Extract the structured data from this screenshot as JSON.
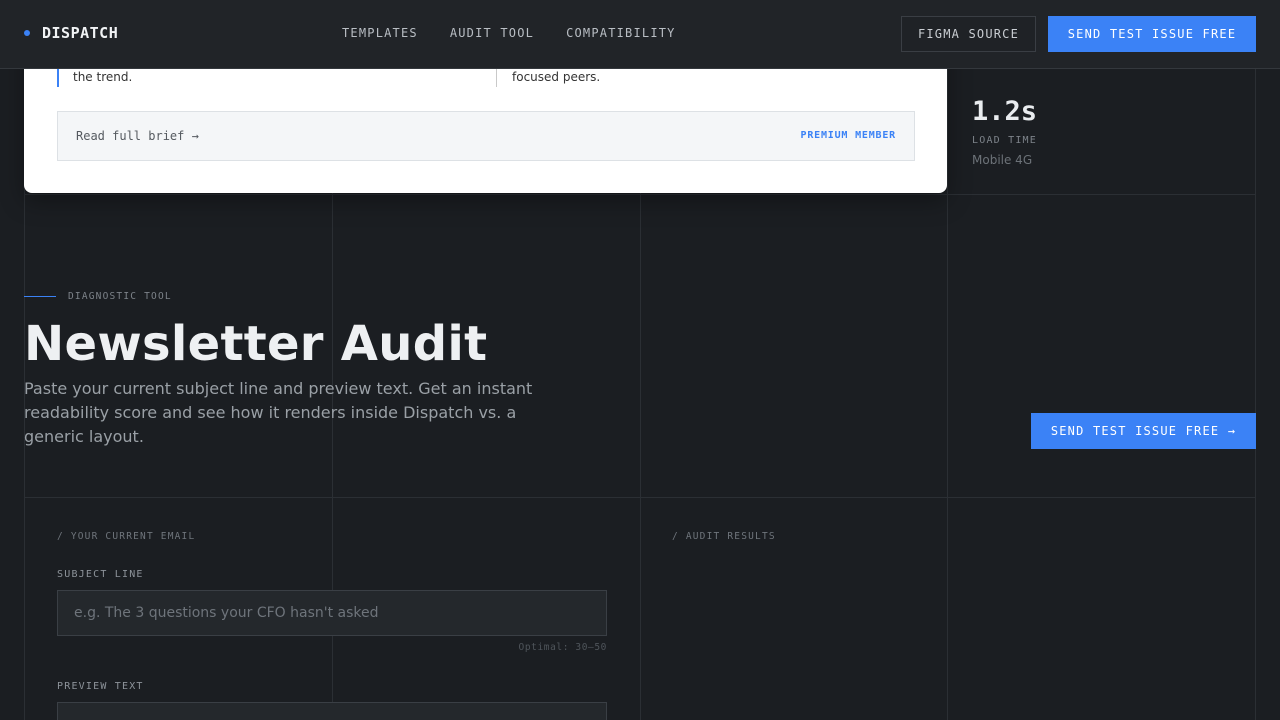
{
  "nav": {
    "brand": "DISPATCH",
    "links": [
      "TEMPLATES",
      "AUDIT TOOL",
      "COMPATIBILITY"
    ],
    "figma_label": "FIGMA SOURCE",
    "cta_label": "SEND TEST ISSUE FREE"
  },
  "brief_card": {
    "col1_text": "the trend.",
    "col2_text": "focused peers.",
    "read_link": "Read full brief →",
    "badge": "PREMIUM MEMBER"
  },
  "stat": {
    "value": "1.2s",
    "label": "LOAD TIME",
    "sub": "Mobile 4G"
  },
  "audit": {
    "eyebrow": "DIAGNOSTIC TOOL",
    "title": "Newsletter Audit",
    "description": "Paste your current subject line and preview text. Get an instant readability score and see how it renders inside Dispatch vs. a generic layout.",
    "cta_label": "SEND TEST ISSUE FREE →"
  },
  "form": {
    "panel_label": "/ YOUR CURRENT EMAIL",
    "subject_label": "SUBJECT LINE",
    "subject_placeholder": "e.g. The 3 questions your CFO hasn't asked",
    "subject_hint": "Optimal: 30–50",
    "preview_label": "PREVIEW TEXT"
  },
  "results": {
    "panel_label": "/ AUDIT RESULTS"
  },
  "colors": {
    "accent": "#3b82f6",
    "background": "#1b1e22"
  }
}
